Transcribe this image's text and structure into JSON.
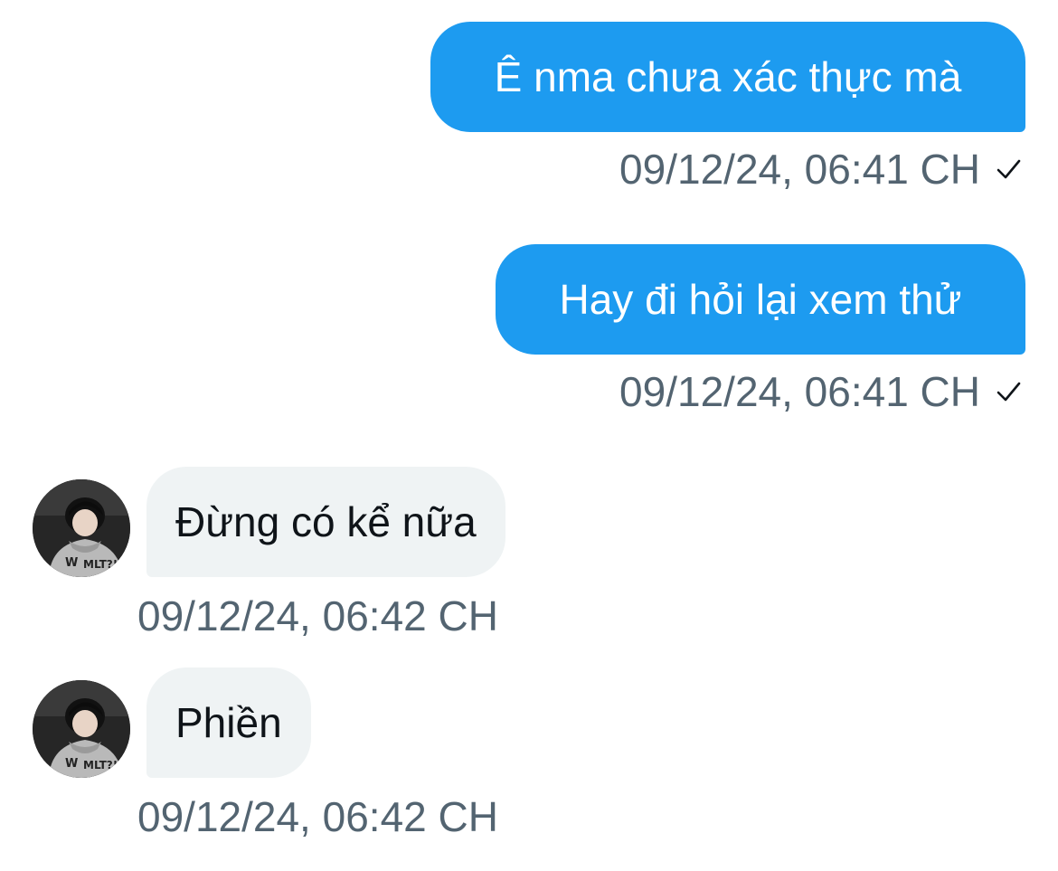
{
  "conversation": {
    "messages": [
      {
        "direction": "outgoing",
        "text": "Ê nma chưa xác thực mà",
        "timestamp": "09/12/24, 06:41 CH",
        "status_icon": "check-icon"
      },
      {
        "direction": "outgoing",
        "text": "Hay đi hỏi lại xem thử",
        "timestamp": "09/12/24, 06:41 CH",
        "status_icon": "check-icon"
      },
      {
        "direction": "incoming",
        "text": "Đừng có kể nữa",
        "timestamp": "09/12/24, 06:42 CH",
        "avatar_icon": "user-avatar"
      },
      {
        "direction": "incoming",
        "text": "Phiền",
        "timestamp": "09/12/24, 06:42 CH",
        "avatar_icon": "user-avatar"
      }
    ]
  },
  "colors": {
    "outgoing_bubble": "#1d9bf0",
    "incoming_bubble": "#eff3f4",
    "timestamp_text": "#536471"
  }
}
